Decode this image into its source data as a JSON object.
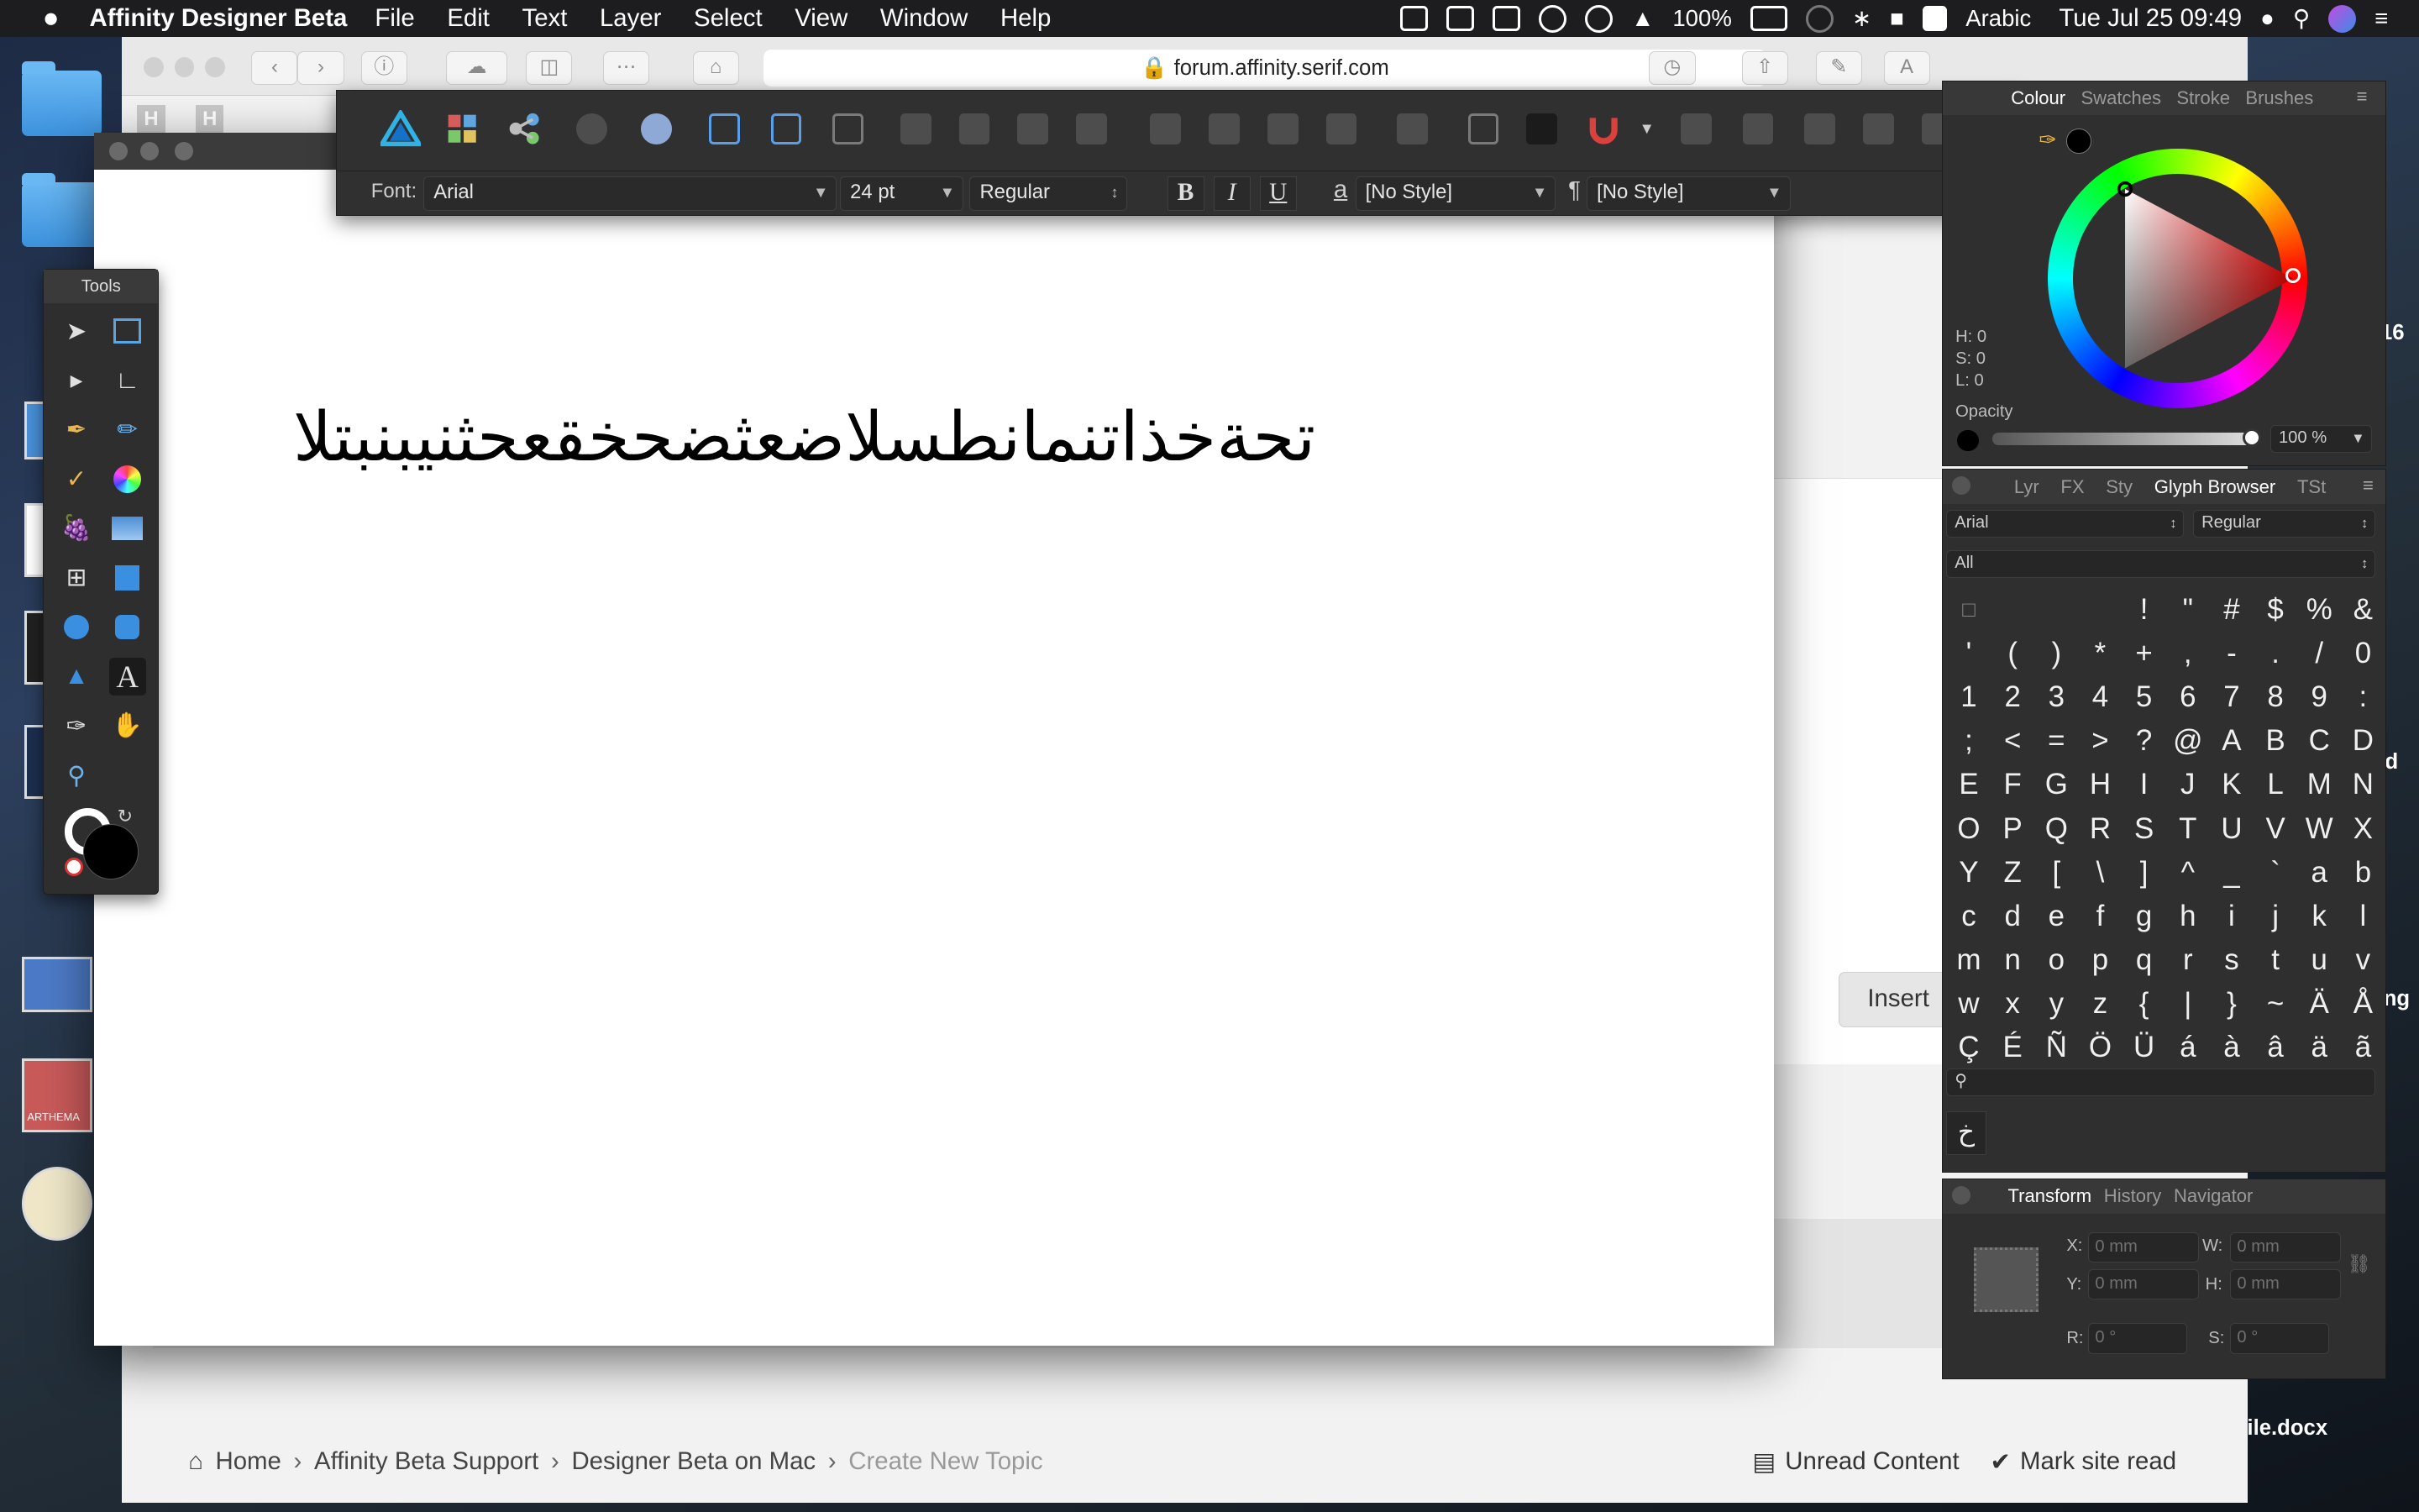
{
  "menubar": {
    "app_name": "Affinity Designer Beta",
    "menus": [
      "File",
      "Edit",
      "Text",
      "Layer",
      "Select",
      "View",
      "Window",
      "Help"
    ],
    "battery": "100%",
    "input_source": "Arabic",
    "datetime": "Tue Jul 25  09:49"
  },
  "safari": {
    "url": "forum.affinity.serif.com",
    "insert_button": "Insert",
    "breadcrumb": [
      "Home",
      "Affinity Beta Support",
      "Designer Beta on Mac",
      "Create New Topic"
    ],
    "unread_content": "Unread Content",
    "mark_site_read": "Mark site read",
    "h_tab_1": "H",
    "h_tab_2": "H"
  },
  "desktop": {
    "edge_text_1": "16",
    "edge_text_2": "d",
    "edge_text_3": "ng",
    "file_label": "file.docx",
    "thumb_label": "ARTHEMA"
  },
  "context_toolbar": {
    "font_label": "Font:",
    "font_value": "Arial",
    "size_value": "24 pt",
    "weight_value": "Regular",
    "bold": "B",
    "italic": "I",
    "underline": "U",
    "char_style_icon": "a",
    "char_style": "[No Style]",
    "para_style_icon": "¶",
    "para_style": "[No Style]",
    "more": "»"
  },
  "document": {
    "arabic_text": "تحةخذاتنمانطسلاضعثضحخقعحثنيبنبتلا"
  },
  "tools_panel": {
    "title": "Tools"
  },
  "colour_panel": {
    "tabs": [
      "Colour",
      "Swatches",
      "Stroke",
      "Brushes"
    ],
    "h": "H: 0",
    "s": "S: 0",
    "l": "L: 0",
    "opacity_label": "Opacity",
    "opacity_value": "100 %"
  },
  "glyph_panel": {
    "tabs": [
      "Lyr",
      "FX",
      "Sty",
      "Glyph Browser",
      "TSt"
    ],
    "font": "Arial",
    "style": "Regular",
    "subset": "All",
    "preview_glyph": "خ",
    "glyphs": [
      "□",
      "",
      "",
      "",
      "!",
      "\"",
      "#",
      "$",
      "%",
      "&",
      "'",
      "(",
      ")",
      "*",
      "+",
      ",",
      "-",
      ".",
      "/",
      "0",
      "1",
      "2",
      "3",
      "4",
      "5",
      "6",
      "7",
      "8",
      "9",
      ":",
      ";",
      "<",
      "=",
      ">",
      "?",
      "@",
      "A",
      "B",
      "C",
      "D",
      "E",
      "F",
      "G",
      "H",
      "I",
      "J",
      "K",
      "L",
      "M",
      "N",
      "O",
      "P",
      "Q",
      "R",
      "S",
      "T",
      "U",
      "V",
      "W",
      "X",
      "Y",
      "Z",
      "[",
      "\\",
      "]",
      "^",
      "_",
      "`",
      "a",
      "b",
      "c",
      "d",
      "e",
      "f",
      "g",
      "h",
      "i",
      "j",
      "k",
      "l",
      "m",
      "n",
      "o",
      "p",
      "q",
      "r",
      "s",
      "t",
      "u",
      "v",
      "w",
      "x",
      "y",
      "z",
      "{",
      "|",
      "}",
      "~",
      "Ä",
      "Å",
      "Ç",
      "É",
      "Ñ",
      "Ö",
      "Ü",
      "á",
      "à",
      "â",
      "ä",
      "ã"
    ]
  },
  "transform_panel": {
    "tabs": [
      "Transform",
      "History",
      "Navigator"
    ],
    "x_label": "X:",
    "x_value": "0 mm",
    "y_label": "Y:",
    "y_value": "0 mm",
    "w_label": "W:",
    "w_value": "0 mm",
    "h_label": "H:",
    "h_value": "0 mm",
    "r_label": "R:",
    "r_value": "0 °",
    "s_label": "S:",
    "s_value": "0 °"
  },
  "colors": {
    "panel_bg": "#2f2f2f",
    "accent_blue": "#1f8fe5"
  }
}
